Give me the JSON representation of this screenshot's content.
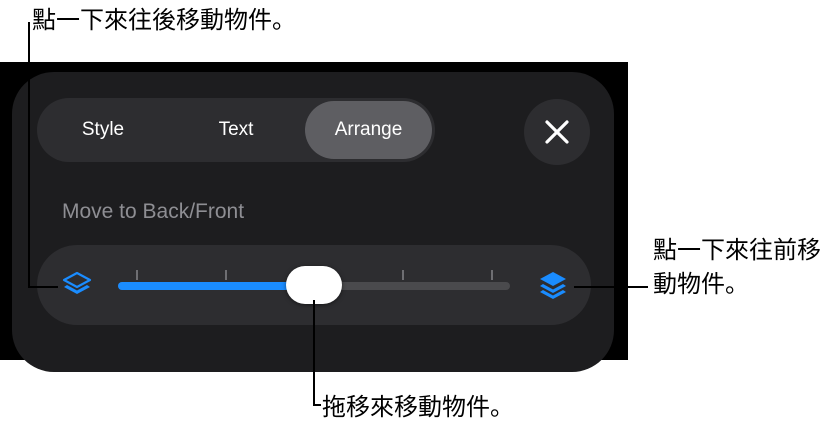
{
  "callouts": {
    "move_back": "點一下來往後移動物件。",
    "move_front": "點一下來往前移動物件。",
    "drag": "拖移來移動物件。"
  },
  "tabs": [
    {
      "label": "Style",
      "selected": false
    },
    {
      "label": "Text",
      "selected": false
    },
    {
      "label": "Arrange",
      "selected": true
    }
  ],
  "section": {
    "label": "Move to Back/Front"
  },
  "slider": {
    "value_fraction": 0.5
  },
  "colors": {
    "accent": "#1a8cff",
    "panel": "#1d1d1f"
  },
  "icons": {
    "close": "close-icon",
    "back": "layers-back-icon",
    "front": "layers-front-icon"
  }
}
